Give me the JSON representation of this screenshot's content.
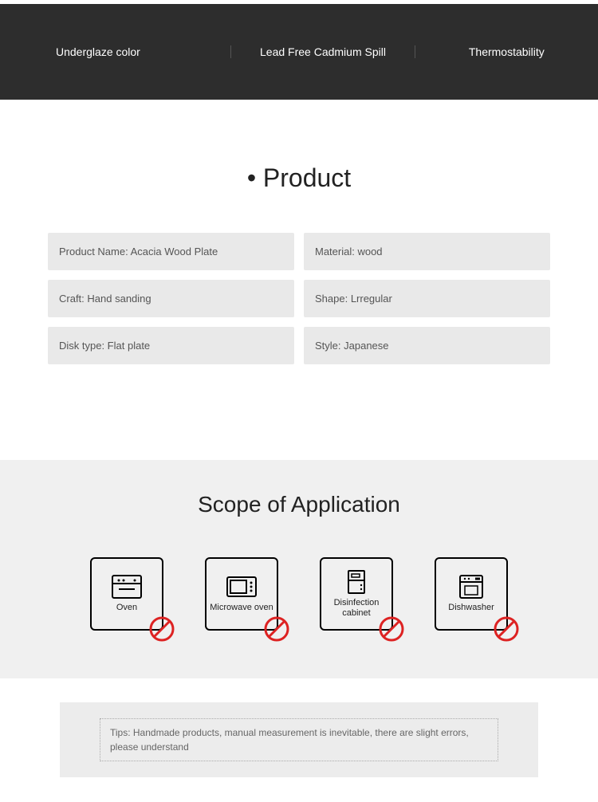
{
  "features": {
    "a": "Underglaze color",
    "b": "Lead Free Cadmium Spill",
    "c": "Thermostability"
  },
  "product": {
    "heading": "Product",
    "specs": {
      "name": "Product Name: Acacia Wood Plate",
      "material": "Material: wood",
      "craft": "Craft: Hand sanding",
      "shape": "Shape: Lrregular",
      "disk_type": "Disk type: Flat plate",
      "style": "Style: Japanese"
    }
  },
  "scope": {
    "heading": "Scope of Application",
    "items": {
      "oven": "Oven",
      "microwave": "Microwave oven",
      "disinfection": "Disinfection cabinet",
      "dishwasher": "Dishwasher"
    }
  },
  "tips": {
    "text": "Tips: Handmade products, manual measurement is inevitable, there are slight errors, please understand"
  }
}
